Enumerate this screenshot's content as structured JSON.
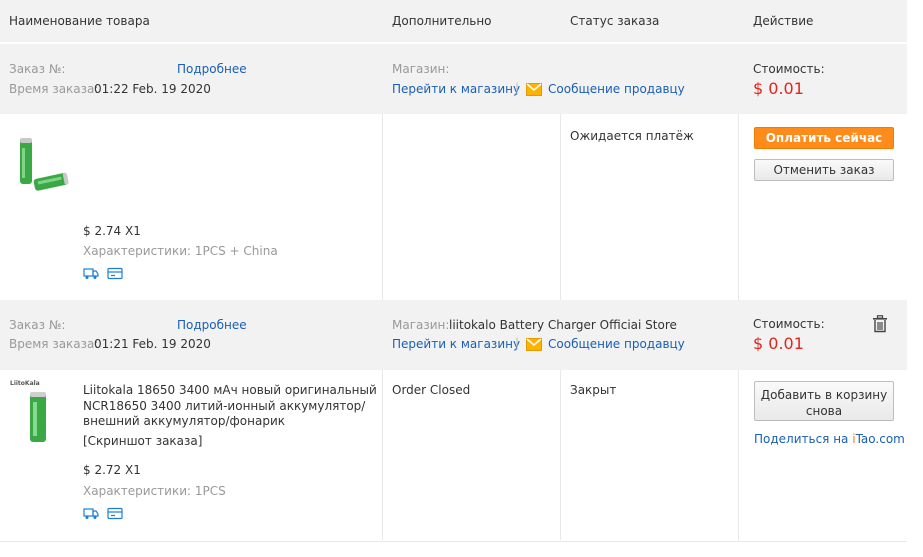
{
  "header": {
    "col_product": "Наименование товара",
    "col_extra": "Дополнительно",
    "col_status": "Статус заказа",
    "col_action": "Действие"
  },
  "orders": [
    {
      "order_no_label": "Заказ №:",
      "details_link": "Подробнее",
      "order_time_label": "Время заказа:",
      "order_time": "01:22 Feb. 19 2020",
      "store_label": "Магазин:",
      "store_name": "",
      "go_to_store": "Перейти к магазину",
      "separator": "|",
      "message_seller": "Сообщение продавцу",
      "cost_label": "Стоимость:",
      "cost": "$ 0.01",
      "item": {
        "title": "",
        "price_qty": "$ 2.74 X1",
        "specs": "Характеристики: 1PCS + China"
      },
      "extra": "",
      "status": "Ожидается платёж",
      "actions": {
        "primary": "Оплатить сейчас",
        "secondary": "Отменить заказ"
      }
    },
    {
      "order_no_label": "Заказ №:",
      "details_link": "Подробнее",
      "order_time_label": "Время заказа:",
      "order_time": "01:21 Feb. 19 2020",
      "store_label": "Магазин:",
      "store_name": "liitokalo Battery Charger Officiai Store",
      "go_to_store": "Перейти к магазину",
      "separator": "|",
      "message_seller": "Сообщение продавцу",
      "cost_label": "Стоимость:",
      "cost": "$ 0.01",
      "item": {
        "title_line1": "Liitokala 18650 3400 мАч новый оригинальный",
        "title_line2": "NCR18650 3400 литий-ионный аккумулятор/",
        "title_line3": "внешний аккумулятор/фонарик",
        "snapshot": "[Скриншот заказа]",
        "price_qty": "$ 2.72 X1",
        "specs": "Характеристики: 1PCS",
        "brand_mark": "LiitoKala"
      },
      "extra": "Order Closed",
      "status": "Закрыт",
      "actions": {
        "add_to_cart_line1": "Добавить в корзину",
        "add_to_cart_line2": "снова",
        "share_prefix": "Поделиться на ",
        "share_brand_i": "i",
        "share_brand_rest": "Tao.com"
      }
    }
  ],
  "colors": {
    "accent_orange": "#ff8c1a",
    "price_red": "#e1251b",
    "link_blue": "#1a5fb4",
    "header_bg": "#f2f2f2"
  }
}
